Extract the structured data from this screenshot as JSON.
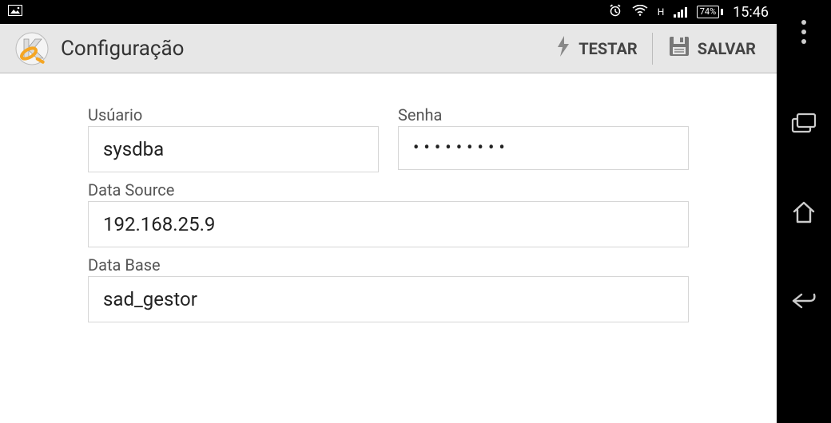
{
  "status_bar": {
    "network_indicator": "H",
    "battery_text": "74%",
    "time": "15:46"
  },
  "toolbar": {
    "title": "Configuração",
    "test_label": "TESTAR",
    "save_label": "SALVAR"
  },
  "form": {
    "user_label": "Usúario",
    "user_value": "sysdba",
    "password_label": "Senha",
    "password_value": "•••••••••",
    "datasource_label": "Data Source",
    "datasource_value": "192.168.25.9",
    "database_label": "Data Base",
    "database_value": "sad_gestor"
  }
}
